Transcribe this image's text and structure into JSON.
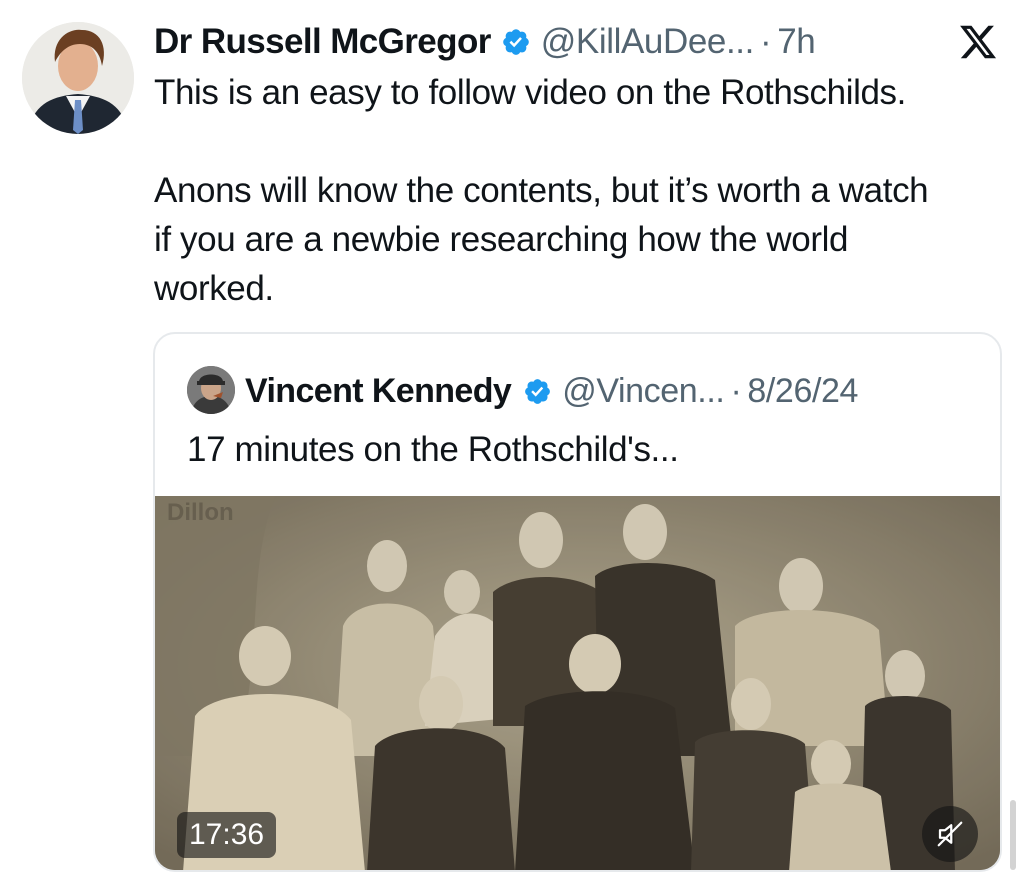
{
  "tweet": {
    "author_name": "Dr Russell McGregor",
    "handle": "@KillAuDee...",
    "separator": "·",
    "time": "7h",
    "paragraphs": [
      "This is an easy to follow video on the Rothschilds.",
      "Anons will know the contents, but it’s worth a watch if you are a newbie researching how the world worked."
    ]
  },
  "quoted_tweet": {
    "author_name": "Vincent Kennedy",
    "handle": "@Vincen...",
    "separator": "·",
    "date": "8/26/24",
    "text": "17 minutes on the Rothschild's...",
    "video": {
      "photo_caption": "Dillon",
      "duration": "17:36",
      "muted": true
    }
  },
  "icons": {
    "verified": "verified-badge-icon",
    "x_logo": "x-logo-icon",
    "mute": "speaker-muted-icon"
  },
  "colors": {
    "text": "#0f1419",
    "muted_text": "#536471",
    "verified_blue": "#1d9bf0",
    "card_border": "#e6e9ec"
  }
}
